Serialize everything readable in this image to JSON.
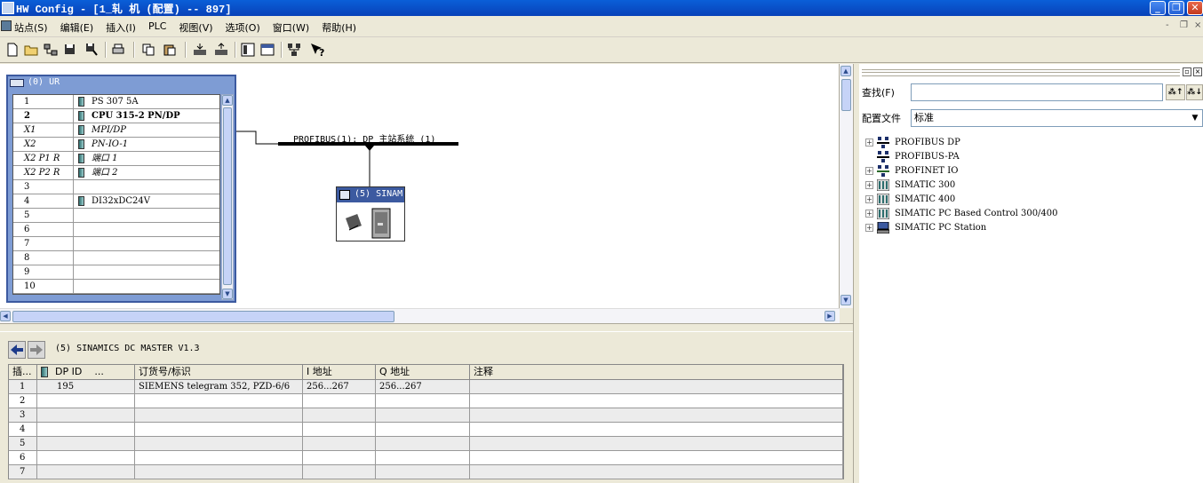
{
  "window": {
    "title": "HW Config - [1_轧 机 (配置) -- 897]",
    "buttons": {
      "minimize": "_",
      "restore": "❐",
      "close": "✕"
    }
  },
  "menu": {
    "items": [
      "站点(S)",
      "编辑(E)",
      "插入(I)",
      "PLC",
      "视图(V)",
      "选项(O)",
      "窗口(W)",
      "帮助(H)"
    ],
    "mdi_buttons": [
      "-",
      "❐",
      "×"
    ]
  },
  "toolbar": {
    "icons": [
      "new-icon",
      "open-icon",
      "network-icon",
      "save-icon",
      "save-compile-icon",
      "print-icon",
      "copy-icon",
      "paste-icon",
      "download-icon",
      "upload-icon",
      "catalog-icon",
      "view-icon",
      "network-view-icon",
      "help-icon"
    ]
  },
  "station": {
    "rack_title": "(0) UR",
    "rack_rows": [
      {
        "slot": "1",
        "module": "PS 307 5A",
        "icon": true,
        "style": ""
      },
      {
        "slot": "2",
        "module": "CPU 315-2 PN/DP",
        "icon": true,
        "style": "bold"
      },
      {
        "slot": "X1",
        "module": "MPI/DP",
        "icon": true,
        "style": "italic"
      },
      {
        "slot": "X2",
        "module": "PN-IO-1",
        "icon": true,
        "style": "italic"
      },
      {
        "slot": "X2 P1 R",
        "module": "端口 1",
        "icon": true,
        "style": "italic"
      },
      {
        "slot": "X2 P2 R",
        "module": "端口 2",
        "icon": true,
        "style": "italic"
      },
      {
        "slot": "3",
        "module": "",
        "icon": false,
        "style": ""
      },
      {
        "slot": "4",
        "module": "DI32xDC24V",
        "icon": true,
        "style": ""
      },
      {
        "slot": "5",
        "module": "",
        "icon": false,
        "style": ""
      },
      {
        "slot": "6",
        "module": "",
        "icon": false,
        "style": ""
      },
      {
        "slot": "7",
        "module": "",
        "icon": false,
        "style": ""
      },
      {
        "slot": "8",
        "module": "",
        "icon": false,
        "style": ""
      },
      {
        "slot": "9",
        "module": "",
        "icon": false,
        "style": ""
      },
      {
        "slot": "10",
        "module": "",
        "icon": false,
        "style": ""
      }
    ],
    "profibus_label": "PROFIBUS(1): DP 主站系统 (1)",
    "slave_title": "(5) SINAM"
  },
  "detail": {
    "module_title": "(5)   SINAMICS DC MASTER V1.3",
    "columns": [
      "插...",
      "DP ID",
      "...",
      "订货号/标识",
      "I 地址",
      "Q 地址",
      "注释"
    ],
    "rows": [
      {
        "slot": "1",
        "dpid": "195",
        "order": "SIEMENS telegram 352, PZD-6/6",
        "i_addr": "256...267",
        "q_addr": "256...267",
        "comment": ""
      },
      {
        "slot": "2",
        "dpid": "",
        "order": "",
        "i_addr": "",
        "q_addr": "",
        "comment": ""
      },
      {
        "slot": "3",
        "dpid": "",
        "order": "",
        "i_addr": "",
        "q_addr": "",
        "comment": ""
      },
      {
        "slot": "4",
        "dpid": "",
        "order": "",
        "i_addr": "",
        "q_addr": "",
        "comment": ""
      },
      {
        "slot": "5",
        "dpid": "",
        "order": "",
        "i_addr": "",
        "q_addr": "",
        "comment": ""
      },
      {
        "slot": "6",
        "dpid": "",
        "order": "",
        "i_addr": "",
        "q_addr": "",
        "comment": ""
      },
      {
        "slot": "7",
        "dpid": "",
        "order": "",
        "i_addr": "",
        "q_addr": "",
        "comment": ""
      }
    ]
  },
  "catalog": {
    "find_label": "查找(F)",
    "find_value": "",
    "profile_label": "配置文件",
    "profile_value": "标准",
    "tree": [
      {
        "label": "PROFIBUS DP",
        "expandable": true,
        "icon": "profibus-dp-icon"
      },
      {
        "label": "PROFIBUS-PA",
        "expandable": false,
        "icon": "profibus-pa-icon"
      },
      {
        "label": "PROFINET IO",
        "expandable": true,
        "icon": "profinet-io-icon"
      },
      {
        "label": "SIMATIC 300",
        "expandable": true,
        "icon": "simatic-rack-icon"
      },
      {
        "label": "SIMATIC 400",
        "expandable": true,
        "icon": "simatic-rack-icon"
      },
      {
        "label": "SIMATIC PC Based Control 300/400",
        "expandable": true,
        "icon": "simatic-rack-icon"
      },
      {
        "label": "SIMATIC PC Station",
        "expandable": true,
        "icon": "pc-station-icon"
      }
    ]
  },
  "colors": {
    "titlebar": "#0a5fd8",
    "rack_border": "#3c5aa0",
    "profibus_line": "#000000"
  }
}
